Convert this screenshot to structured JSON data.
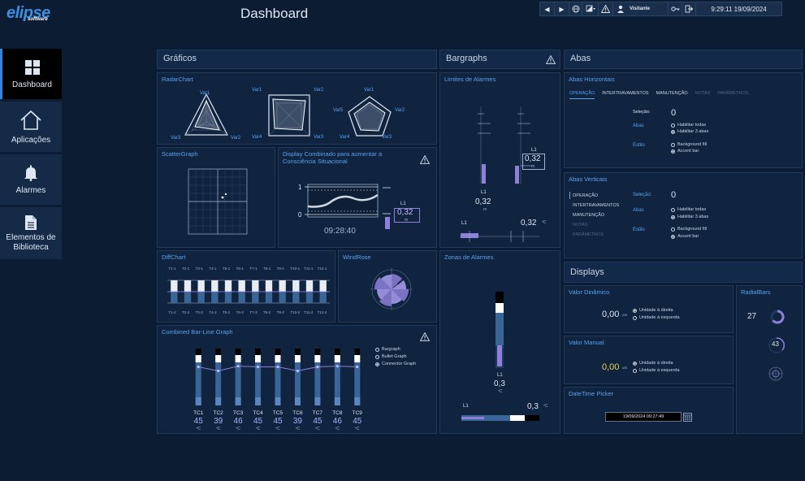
{
  "header": {
    "logo": "elipse",
    "logo_sub": "software",
    "title": "Dashboard",
    "user": "Visitante",
    "datetime": "9:29:11  19/09/2024"
  },
  "nav": [
    {
      "label": "Dashboard",
      "icon": "grid-icon"
    },
    {
      "label": "Aplicações",
      "icon": "home-icon"
    },
    {
      "label": "Alarmes",
      "icon": "bell-icon"
    },
    {
      "label": "Elementos de Biblioteca",
      "icon": "document-icon"
    }
  ],
  "graficos": {
    "title": "Gráficos",
    "radar": {
      "title": "RadarChart",
      "r1": {
        "top": "Var1",
        "bl": "Var3",
        "br": "Var2"
      },
      "r2": {
        "tl": "Var1",
        "tr": "Var2",
        "bl": "Var4",
        "br": "Var3"
      },
      "r3": {
        "top": "Var1",
        "l": "Var5",
        "r": "Var2",
        "bl": "Var4",
        "br": "Var3"
      }
    },
    "scatter": {
      "title": "ScatterGraph"
    },
    "display_combinado": {
      "title": "Display Combinado para aumentar a Consciência Situacional",
      "y_high": "1",
      "y_low": "0",
      "l1": "L1",
      "value": "0,32",
      "unit": "m",
      "time": "09:28:40"
    },
    "diffchart": {
      "title": "DiffChart",
      "top_labels": [
        "T1-1",
        "T2-1",
        "T3-1",
        "T4-1",
        "T5-1",
        "T6-1",
        "T7-1",
        "T8-1",
        "T9-1",
        "T10-1",
        "T11-1",
        "T12-1"
      ],
      "bottom_labels": [
        "T1-2",
        "T2-2",
        "T3-2",
        "T4-2",
        "T5-2",
        "T6-2",
        "T7-2",
        "T8-2",
        "T9-2",
        "T10-2",
        "T11-2",
        "T12-2"
      ]
    },
    "windrose": {
      "title": "WindRose"
    },
    "combined": {
      "title": "Combined Bar-Line Graph",
      "options": [
        "Bargraph",
        "Bullet Graph",
        "Connector Graph"
      ],
      "tags": [
        "TC1",
        "TC2",
        "TC3",
        "TC4",
        "TC5",
        "TC6",
        "TC7",
        "TC8",
        "TC9"
      ],
      "values": [
        45,
        39,
        46,
        45,
        45,
        39,
        45,
        46,
        45
      ],
      "unit": "ºC"
    }
  },
  "bargraphs": {
    "title": "Bargraphs",
    "limites": {
      "title": "Limites de Alarmes",
      "l1_left": "L1",
      "val_left": "0,32",
      "unit_left": "m",
      "l1_right": "L1",
      "val_right": "0,32",
      "unit_right": "m",
      "h_l1": "L1",
      "h_val": "0,32",
      "h_unit": "ºC"
    },
    "zonas": {
      "title": "Zonas de Alarmes",
      "l1": "L1",
      "val": "0,3",
      "unit": "ºC",
      "h_l1": "L1",
      "h_val": "0,3",
      "h_unit": "ºC"
    }
  },
  "abas": {
    "title": "Abas",
    "horizontais": {
      "title": "Abas Horizontais",
      "tabs": [
        "OPERAÇÃO",
        "INTERTRAVAMENTOS",
        "MANUTENÇÃO",
        "NOTAS",
        "PARÂMETROS"
      ],
      "selecao_label": "Seleção:",
      "selecao_value": "0",
      "abas_label": "Abas",
      "abas_opts": [
        "Habilitar todas",
        "Habilitar 3 abas"
      ],
      "estilo_label": "Estilo",
      "estilo_opts": [
        "Background fill",
        "Accent bar"
      ]
    },
    "verticais": {
      "title": "Abas Verticais",
      "tabs": [
        "OPERAÇÃO",
        "INTERTRAVAMENTOS",
        "MANUTENÇÃO",
        "NOTAS",
        "PARÂMETROS"
      ],
      "selecao_label": "Seleção:",
      "selecao_value": "0",
      "abas_label": "Abas",
      "abas_opts": [
        "Habilitar todas",
        "Habilitar 3 abas"
      ],
      "estilo_label": "Estilo",
      "estilo_opts": [
        "Background fill",
        "Accent bar"
      ]
    }
  },
  "displays": {
    "title": "Displays",
    "valor_dinamico": {
      "title": "Valor Dinâmico",
      "value": "0,00",
      "unit": "um",
      "opts": [
        "Unidade à direita",
        "Unidade à esquerda"
      ]
    },
    "valor_manual": {
      "title": "Valor Manual",
      "value": "0,00",
      "unit": "um",
      "opts": [
        "Unidade à direita",
        "Unidade à esquerda"
      ]
    },
    "datetime_picker": {
      "title": "DateTime Picker",
      "value": "19/09/2024 09:27:49"
    },
    "radialbars": {
      "title": "RadialBars",
      "v1": "27",
      "v2": "43"
    }
  },
  "colors": {
    "accent": "#5aa3ee",
    "panel": "#13294a",
    "bg": "#0b1c33",
    "purple": "#8e7fd9"
  }
}
